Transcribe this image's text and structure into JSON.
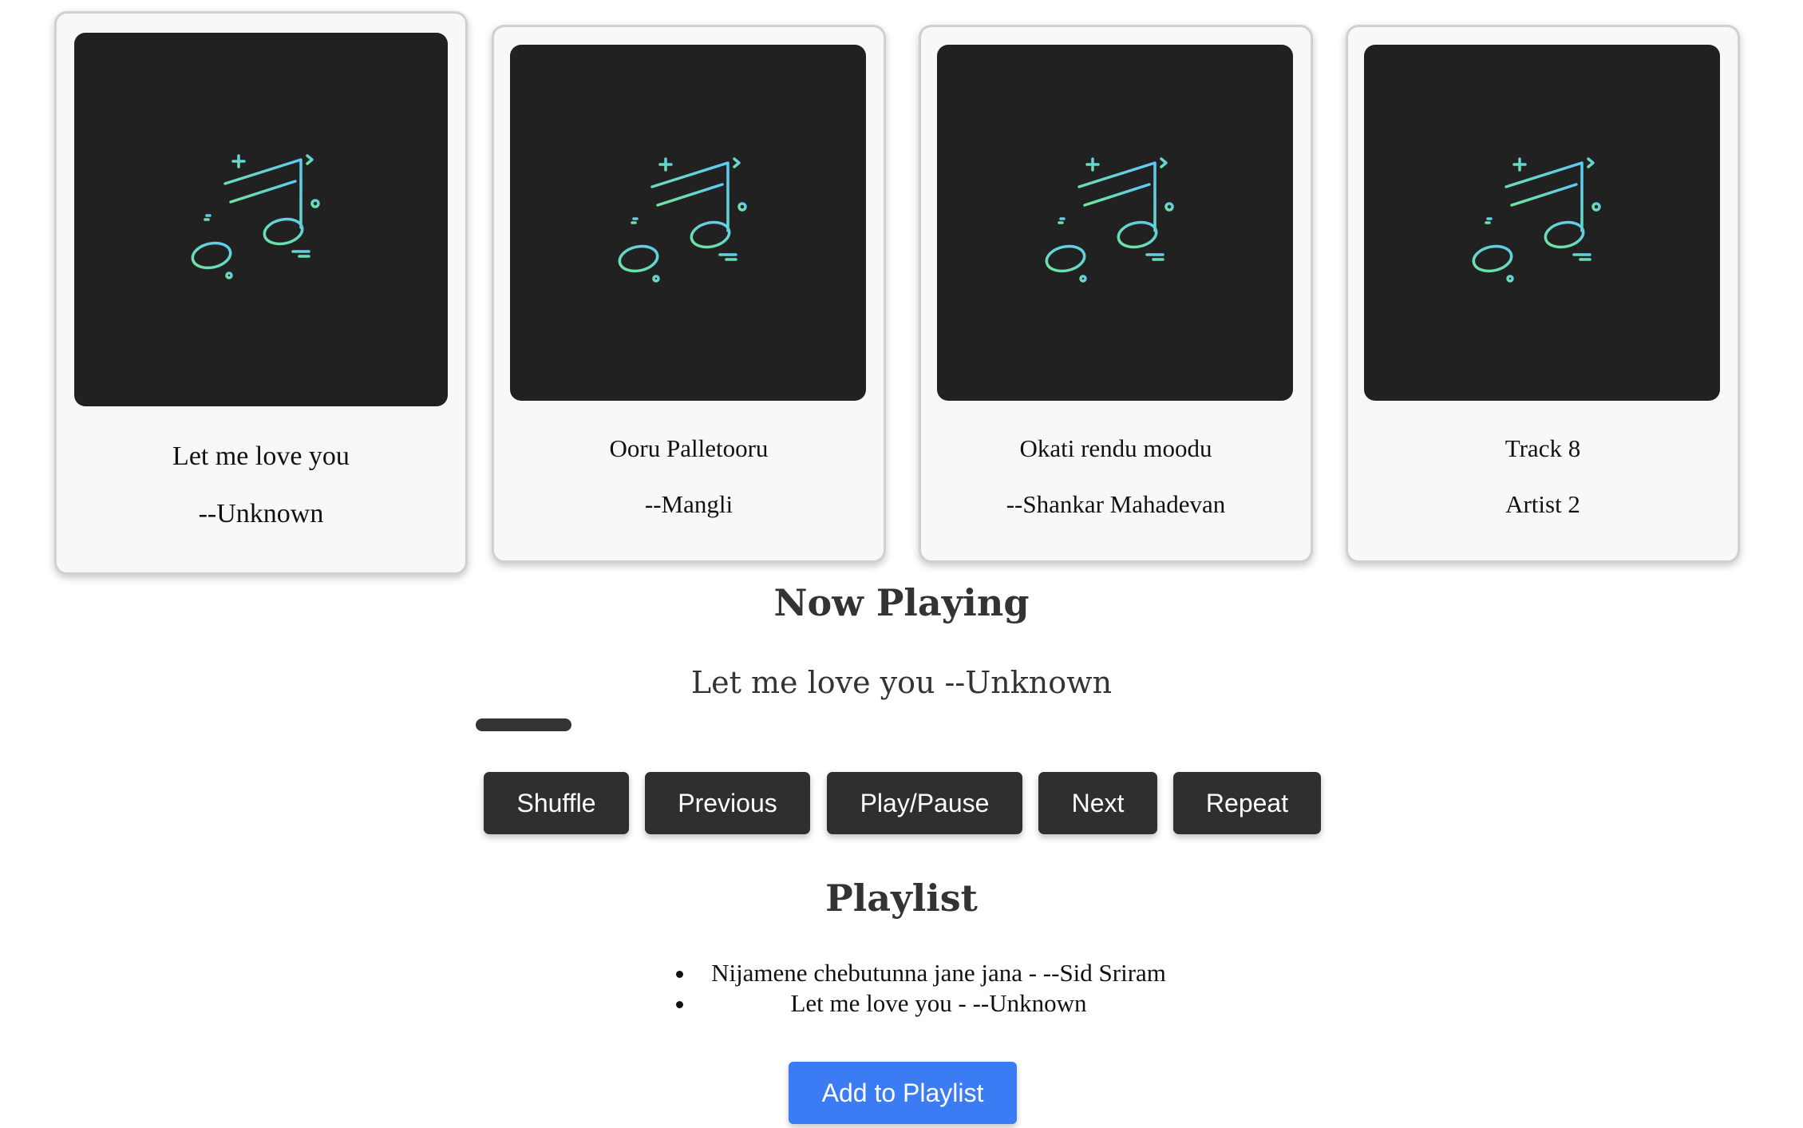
{
  "cards": [
    {
      "title": "Let me love you",
      "artist": "--Unknown",
      "icon": "music-note-icon"
    },
    {
      "title": "Ooru Palletooru",
      "artist": "--Mangli",
      "icon": "music-note-icon"
    },
    {
      "title": "Okati rendu moodu",
      "artist": "--Shankar Mahadevan",
      "icon": "music-note-icon"
    },
    {
      "title": "Track 8",
      "artist": "Artist 2",
      "icon": "music-note-icon"
    }
  ],
  "now_playing": {
    "heading": "Now Playing",
    "track": "Let me love you --Unknown"
  },
  "controls": {
    "shuffle": "Shuffle",
    "previous": "Previous",
    "play_pause": "Play/Pause",
    "next": "Next",
    "repeat": "Repeat"
  },
  "playlist": {
    "heading": "Playlist",
    "items": [
      "Nijamene chebutunna jane jana - --Sid Sriram",
      "Let me love you - --Unknown"
    ],
    "add_label": "Add to Playlist"
  },
  "colors": {
    "card_art_bg": "#212121",
    "button_bg": "#2f2f2f",
    "accent_blue": "#3b7cf4",
    "icon_gradient_start": "#5ec9f5",
    "icon_gradient_end": "#6ee69a"
  }
}
